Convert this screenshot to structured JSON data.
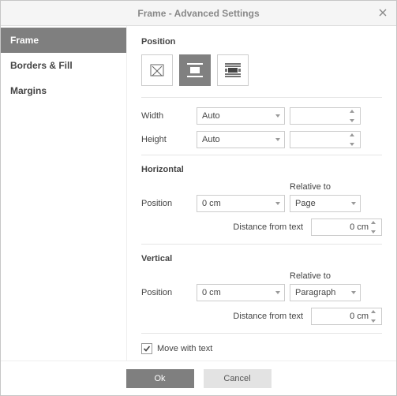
{
  "title": "Frame - Advanced Settings",
  "sidebar": {
    "items": [
      {
        "label": "Frame",
        "active": true
      },
      {
        "label": "Borders & Fill",
        "active": false
      },
      {
        "label": "Margins",
        "active": false
      }
    ]
  },
  "position": {
    "heading": "Position",
    "wrap_selected": 1,
    "width_label": "Width",
    "width_value": "Auto",
    "width_spinner": "",
    "height_label": "Height",
    "height_value": "Auto",
    "height_spinner": ""
  },
  "horizontal": {
    "heading": "Horizontal",
    "relative_to_label": "Relative to",
    "position_label": "Position",
    "position_value": "0 cm",
    "relative_to_value": "Page",
    "distance_label": "Distance from text",
    "distance_value": "0 cm"
  },
  "vertical": {
    "heading": "Vertical",
    "relative_to_label": "Relative to",
    "position_label": "Position",
    "position_value": "0 cm",
    "relative_to_value": "Paragraph",
    "distance_label": "Distance from text",
    "distance_value": "0 cm"
  },
  "move_with_text": {
    "label": "Move with text",
    "checked": true
  },
  "footer": {
    "ok": "Ok",
    "cancel": "Cancel"
  }
}
